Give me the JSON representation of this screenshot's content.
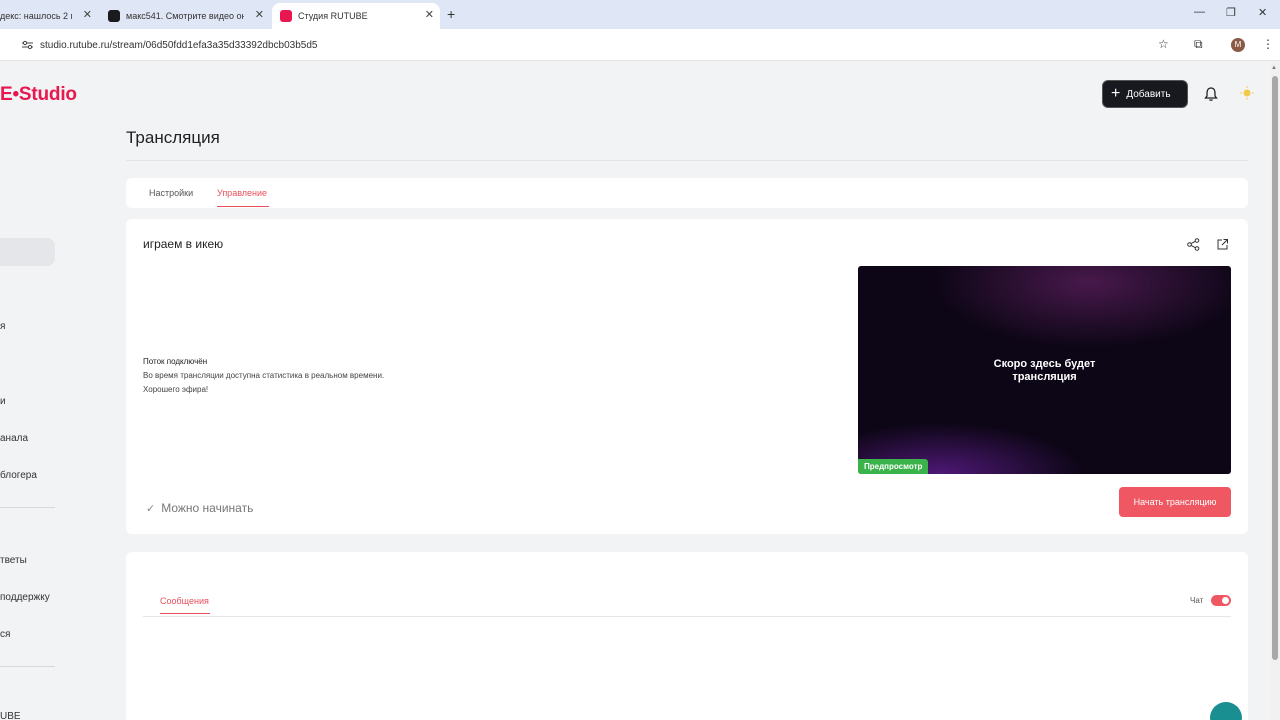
{
  "browser": {
    "tabs": [
      {
        "title": "декс: нашлось 2 м",
        "favicon_color": "#ffffff"
      },
      {
        "title": "макс541. Смотрите видео онл",
        "favicon_color": "#1b1b1f"
      },
      {
        "title": "Студия RUTUBE",
        "favicon_color": "#e8174f"
      }
    ],
    "new_tab": "+",
    "close_glyph": "✕",
    "url": "studio.rutube.ru/stream/06d50fdd1efa3a35d33392dbcb03b5d5",
    "avatar_letter": "M"
  },
  "app": {
    "logo": "E•Studio",
    "add_button": "Добавить",
    "sidebar": {
      "items": [
        "я",
        "и",
        "анала",
        "блогера",
        "тветы",
        "поддержку",
        "ся",
        "UBE"
      ]
    },
    "page_title": "Трансляция",
    "tabs": [
      "Настройки",
      "Управление"
    ],
    "stream": {
      "title": "играем в икею",
      "status_title": "Поток подключён",
      "status_line1": "Во время трансляции доступна статистика в реальном времени.",
      "status_line2": "Хорошего эфира!",
      "preview_text_line1": "Скоро здесь будет",
      "preview_text_line2": "трансляция",
      "preview_badge": "Предпросмотр",
      "ready_label": "Можно начинать",
      "start_button": "Начать трансляцию"
    },
    "chat": {
      "messages_tab": "Сообщения",
      "chat_label": "Чат",
      "chat_enabled": true
    }
  },
  "colors": {
    "accent": "#ef5763",
    "brand": "#e8174f",
    "badge_green": "#3ab34a"
  }
}
